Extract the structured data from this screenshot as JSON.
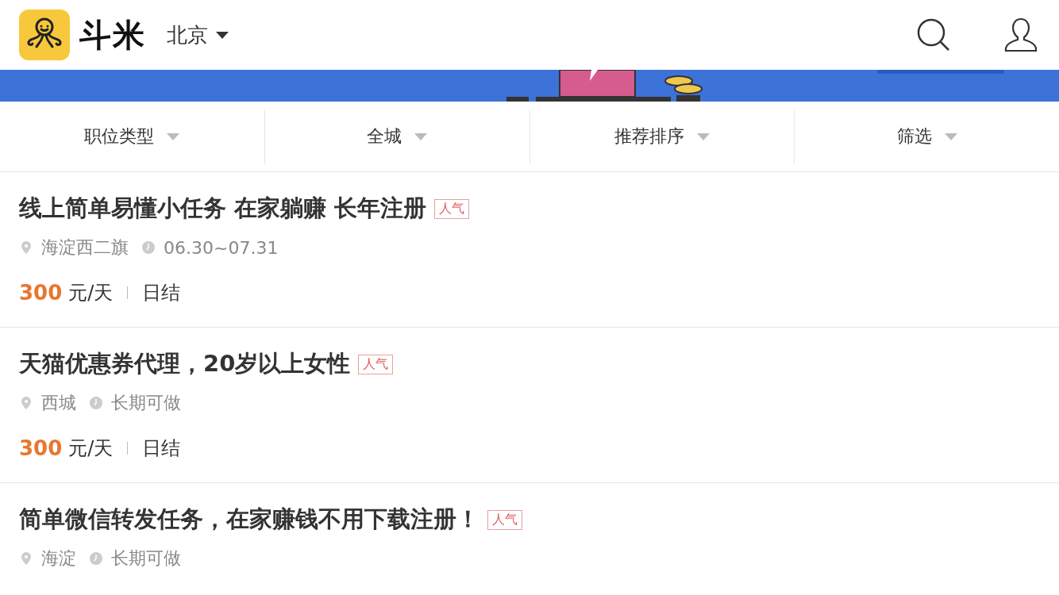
{
  "header": {
    "brand": "斗米",
    "city": "北京"
  },
  "filters": [
    {
      "label": "职位类型"
    },
    {
      "label": "全城"
    },
    {
      "label": "推荐排序"
    },
    {
      "label": "筛选"
    }
  ],
  "jobs": [
    {
      "title": "线上简单易懂小任务 在家躺赚 长年注册",
      "tag": "人气",
      "location": "海淀西二旗",
      "period": "06.30~07.31",
      "pay": "300",
      "unit": "元/天",
      "settlement": "日结"
    },
    {
      "title": "天猫优惠券代理，20岁以上女性",
      "tag": "人气",
      "location": "西城",
      "period": "长期可做",
      "pay": "300",
      "unit": "元/天",
      "settlement": "日结"
    },
    {
      "title": "简单微信转发任务，在家赚钱不用下载注册！",
      "tag": "人气",
      "location": "海淀",
      "period": "长期可做"
    }
  ]
}
